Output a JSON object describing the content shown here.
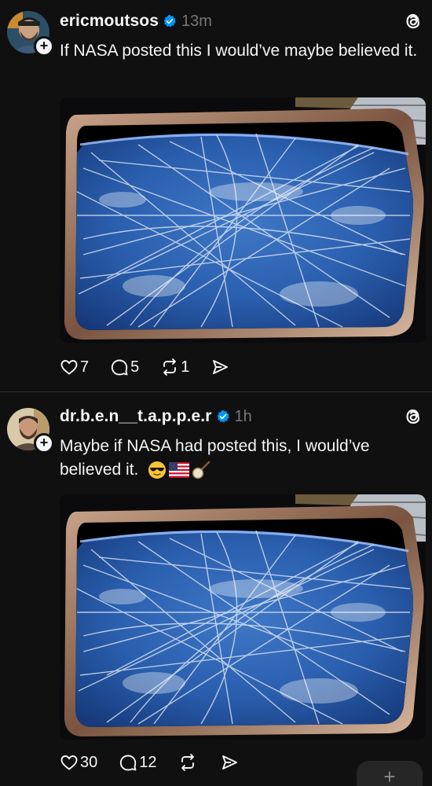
{
  "posts": [
    {
      "username": "ericmoutsos",
      "timestamp": "13m",
      "text": "If NASA posted this I would’ve maybe believed it.",
      "image_alt": "Earth seen from a spacecraft window covered with crisscrossing contrails",
      "likes": "7",
      "replies": "5",
      "reposts": "1"
    },
    {
      "username": "dr.b.e.n__t.a.p.p.e.r",
      "timestamp": "1h",
      "text": "Maybe if NASA had posted this, I would’ve believed it.",
      "emojis": [
        "sunglasses-emoji",
        "us-flag-emoji",
        "banjo-emoji"
      ],
      "image_alt": "Earth seen from a spacecraft window covered with crisscrossing contrails",
      "likes": "30",
      "replies": "12",
      "reposts": ""
    }
  ],
  "icons": {
    "verified": "verified-badge-icon",
    "threads": "threads-logo-icon",
    "like": "heart-icon",
    "reply": "comment-icon",
    "repost": "repost-icon",
    "share": "send-icon",
    "follow": "plus-icon"
  },
  "fab_label": "+",
  "colors": {
    "background": "#101010",
    "text": "#f3f5f7",
    "muted": "#777777",
    "verified": "#0095f6"
  }
}
